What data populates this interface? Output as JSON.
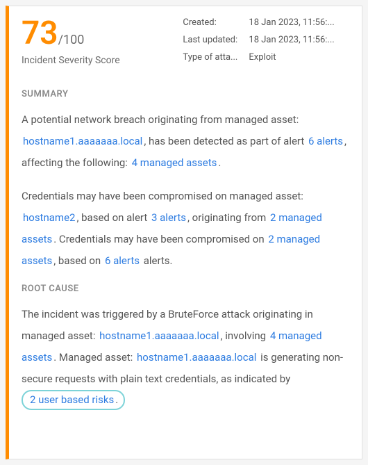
{
  "score": {
    "value": "73",
    "denom": "/100",
    "label": "Incident Severity Score"
  },
  "meta": {
    "created_key": "Created:",
    "created_val": "18 Jan 2023, 11:56:...",
    "last_updated_key": "Last updated:",
    "last_updated_val": "18 Jan 2023, 11:56:...",
    "type_key": "Type of atta...",
    "type_val": "Exploit"
  },
  "sections": {
    "summary_title": "SUMMARY",
    "root_cause_title": "ROOT CAUSE"
  },
  "summary": {
    "p1_t1": "A potential network breach originating from managed asset: ",
    "p1_link1": "hostname1.aaaaaaa.local",
    "p1_t2": ", has been detected as part of alert ",
    "p1_link2": "6 alerts",
    "p1_t3": ", affecting the following: ",
    "p1_link3": "4 managed assets",
    "p1_t4": ".",
    "p2_t1": "Credentials may have been compromised on managed asset: ",
    "p2_link1": "hostname2",
    "p2_t2": ", based on alert ",
    "p2_link2": "3 alerts",
    "p2_t3": ", originating from ",
    "p2_link3": "2 managed assets",
    "p2_t4": ". Credentials may have been compromised on ",
    "p2_link4": "2 managed assets",
    "p2_t5": ", based on ",
    "p2_link5": "6 alerts",
    "p2_t6": " alerts."
  },
  "root_cause": {
    "t1": "The incident was triggered by a BruteForce attack originating in managed asset: ",
    "link1": "hostname1.aaaaaaa.local",
    "t2": ", involving ",
    "link2": "4 managed assets",
    "t3": ". Managed asset: ",
    "link3": "hostname1.aaaaaaa.local",
    "t4": " is generating non-secure requests with plain text credentials, as indicated by ",
    "link4": "2 user based risks",
    "t5": "."
  }
}
